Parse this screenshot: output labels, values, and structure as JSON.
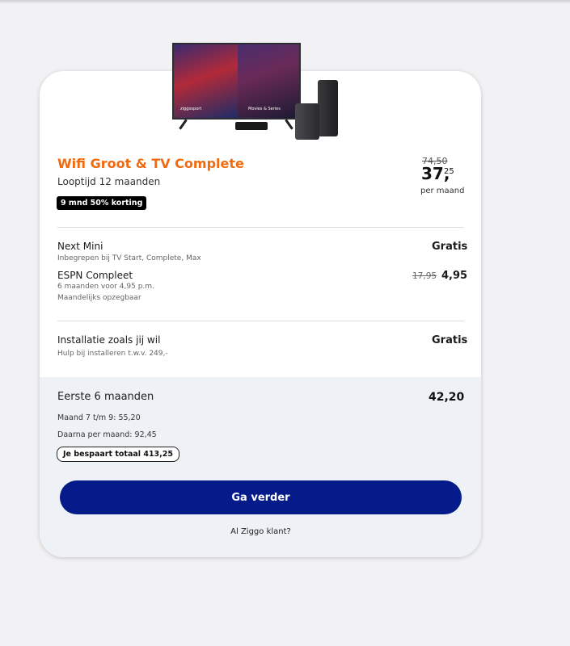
{
  "product": {
    "title": "Wifi Groot & TV Complete",
    "duration": "Looptijd 12 maanden",
    "discount_badge": "9 mnd 50% korting",
    "image": {
      "tv_left_label": "ziggosport",
      "tv_right_label": "Movies & Series"
    },
    "price_old": "74,50",
    "price_main": "37,",
    "price_cents": "25",
    "price_unit": "per maand"
  },
  "items": [
    {
      "name": "Next Mini",
      "sub": "Inbegrepen bij TV Start, Complete, Max",
      "price": "Gratis"
    },
    {
      "name": "ESPN Compleet",
      "sub1": "6 maanden voor 4,95 p.m.",
      "sub2": "Maandelijks opzegbaar",
      "price_old": "17,95",
      "price": "4,95"
    },
    {
      "name": "Installatie zoals jij wil",
      "sub": "Hulp bij installeren t.w.v. 249,-",
      "price": "Gratis"
    }
  ],
  "summary": {
    "title": "Eerste 6 maanden",
    "total": "42,20",
    "line1": "Maand 7 t/m 9: 55,20",
    "line2": "Daarna per maand: 92,45",
    "savings_badge": "Je bespaart totaal 413,25"
  },
  "cta": {
    "label": "Ga verder"
  },
  "login_link": "Al Ziggo klant?",
  "colors": {
    "accent": "#f26a10",
    "cta": "#051b8a",
    "summary_bg": "#eef2f6"
  }
}
